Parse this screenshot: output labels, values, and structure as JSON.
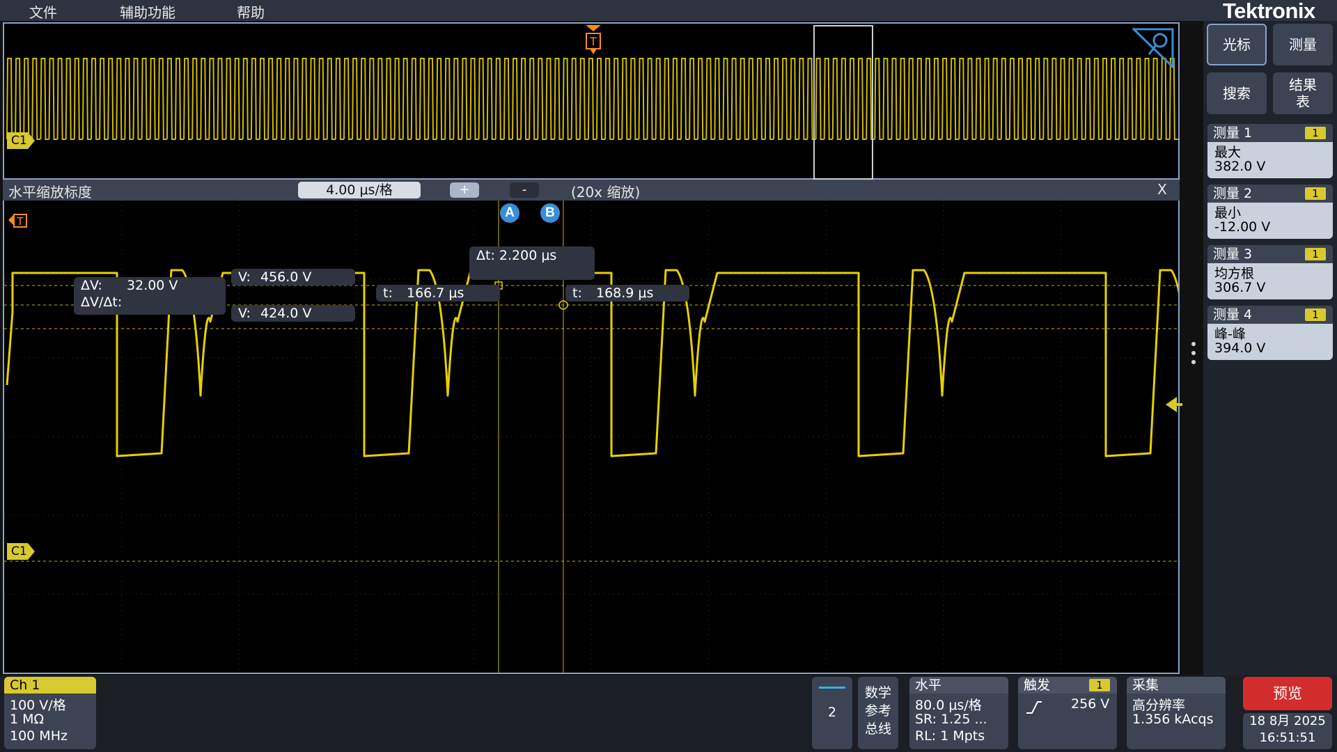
{
  "menu": {
    "items": [
      "文件",
      "辅助功能",
      "帮助"
    ]
  },
  "brand": {
    "logo": "Tektronix"
  },
  "overview": {
    "channel_tag": "C1",
    "trigger_tag": "T"
  },
  "zoom": {
    "title": "水平缩放标度",
    "scale": "4.00 μs/格",
    "plus": "+",
    "minus": "-",
    "info": "(20x 缩放)",
    "close": "X"
  },
  "main": {
    "channel_tag": "C1",
    "trigger_tag": "T",
    "cursor_a": "A",
    "cursor_b": "B",
    "delta_t": "Δt:  2.200 μs",
    "delta_v_label": "ΔV:",
    "delta_v_value": "32.00 V",
    "dv_dt_label": "ΔV/Δt:",
    "v_a_label": "V:",
    "v_a_value": "456.0 V",
    "v_b_label": "V:",
    "v_b_value": "424.0 V",
    "t_a_label": "t:",
    "t_a_value": "166.7 μs",
    "t_b_label": "t:",
    "t_b_value": "168.9 μs"
  },
  "sidebar": {
    "buttons": [
      "光标",
      "测量",
      "搜索",
      "结果\n表"
    ],
    "measurements": [
      {
        "title": "测量 1",
        "ch": "1",
        "type": "最大",
        "value": "382.0 V"
      },
      {
        "title": "测量 2",
        "ch": "1",
        "type": "最小",
        "value": "-12.00 V"
      },
      {
        "title": "测量 3",
        "ch": "1",
        "type": "均方根",
        "value": "306.7 V"
      },
      {
        "title": "测量 4",
        "ch": "1",
        "type": "峰-峰",
        "value": "394.0 V"
      }
    ]
  },
  "bottom": {
    "ch1": {
      "title": "Ch 1",
      "scale": "100 V/格",
      "impedance": "1 MΩ",
      "bandwidth": "100 MHz"
    },
    "add_number": "2",
    "math_ref_bus": "数学\n参考\n总线",
    "horizontal": {
      "title": "水平",
      "scale": "80.0 μs/格",
      "sr": "SR: 1.25 ...",
      "rl": "RL: 1 Mpts"
    },
    "trigger": {
      "title": "触发",
      "ch": "1",
      "level": "256 V"
    },
    "acquire": {
      "title": "采集",
      "mode": "高分辨率",
      "count": "1.356 kAcqs"
    },
    "preview": "预览",
    "date": "18 8月 2025",
    "time": "16:51:51"
  },
  "colors": {
    "trace": "#e8d000",
    "accent": "#3a8ed8",
    "panel": "#3c4352",
    "stop": "#d22c2c"
  }
}
